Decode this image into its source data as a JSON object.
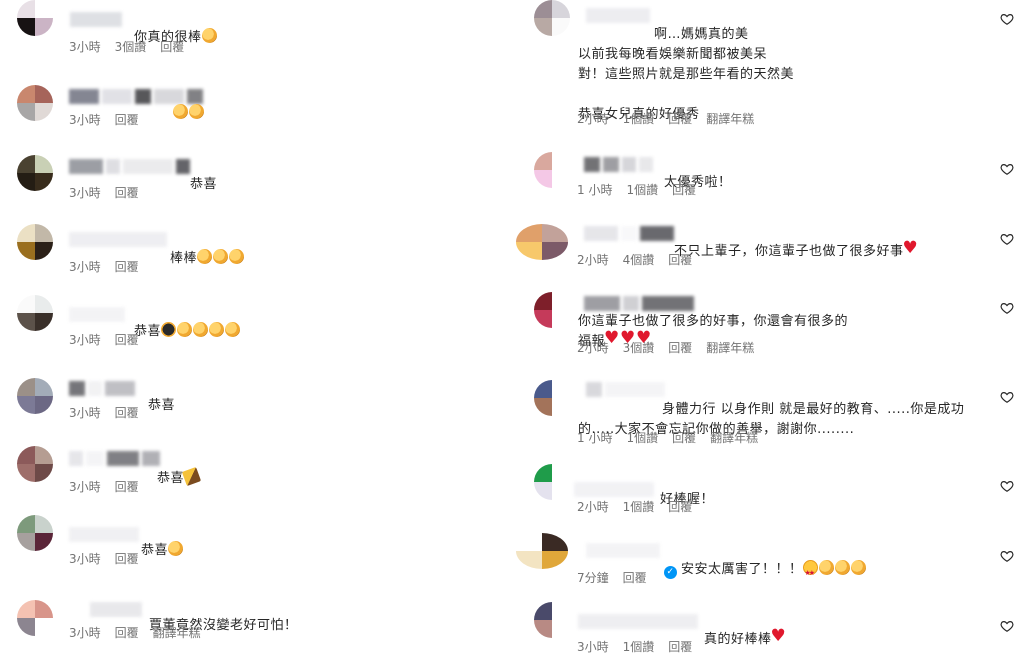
{
  "left_comments": [
    {
      "text": "你真的很棒",
      "emoji": [
        "clap"
      ],
      "time": "3小時",
      "likes": "3個讚",
      "reply": "回覆",
      "translate": ""
    },
    {
      "text": "",
      "emoji": [
        "clap",
        "clap"
      ],
      "time": "3小時",
      "likes": "",
      "reply": "回覆",
      "translate": ""
    },
    {
      "text": "恭喜",
      "emoji": [],
      "time": "3小時",
      "likes": "",
      "reply": "回覆",
      "translate": ""
    },
    {
      "text": "棒棒",
      "emoji": [
        "clap",
        "clap",
        "clap"
      ],
      "time": "3小時",
      "likes": "",
      "reply": "回覆",
      "translate": ""
    },
    {
      "text": "恭喜",
      "emoji": [
        "blackclap",
        "clap",
        "clap",
        "clap",
        "clap"
      ],
      "time": "3小時",
      "likes": "",
      "reply": "回覆",
      "translate": ""
    },
    {
      "text": "恭喜",
      "emoji": [],
      "time": "3小時",
      "likes": "",
      "reply": "回覆",
      "translate": ""
    },
    {
      "text": "恭喜",
      "emoji": [
        "party"
      ],
      "time": "3小時",
      "likes": "",
      "reply": "回覆",
      "translate": ""
    },
    {
      "text": "恭喜",
      "emoji": [
        "clap"
      ],
      "time": "3小時",
      "likes": "",
      "reply": "回覆",
      "translate": ""
    },
    {
      "text": "賈董竟然沒變老好可怕！",
      "emoji": [],
      "time": "3小時",
      "likes": "",
      "reply": "回覆",
      "translate": "翻譯年糕"
    }
  ],
  "right_comments": [
    {
      "text": "啊…媽媽真的美\n以前我每晚看娛樂新聞都被美呆\n對！這些照片就是那些年看的天然美\n\n恭喜女兒真的好優秀",
      "emoji": [],
      "time": "2小時",
      "likes": "1個讚",
      "reply": "回覆",
      "translate": "翻譯年糕"
    },
    {
      "text": "太優秀啦！",
      "emoji": [],
      "time": "1 小時",
      "likes": "1個讚",
      "reply": "回覆",
      "translate": ""
    },
    {
      "text": "不只上輩子，你這輩子也做了很多好事",
      "emoji": [
        "redheart"
      ],
      "time": "2小時",
      "likes": "4個讚",
      "reply": "回覆",
      "translate": ""
    },
    {
      "text": "你這輩子也做了很多的好事，你還會有很多的\n福報",
      "emoji": [
        "redheart",
        "redheart",
        "redheart"
      ],
      "time": "2小時",
      "likes": "3個讚",
      "reply": "回覆",
      "translate": "翻譯年糕"
    },
    {
      "text": "身體力行 以身作則 就是最好的教育、.....你是成功\n的.....大家不會忘記你做的善舉，謝謝你........",
      "emoji": [],
      "time": "1 小時",
      "likes": "1個讚",
      "reply": "回覆",
      "translate": "翻譯年糕"
    },
    {
      "text": "好棒喔！",
      "emoji": [],
      "time": "2小時",
      "likes": "1個讚",
      "reply": "回覆",
      "translate": ""
    },
    {
      "text": "安安太厲害了！！！",
      "emoji": [
        "starface",
        "clap",
        "clap",
        "clap"
      ],
      "time": "7分鐘",
      "likes": "",
      "reply": "回覆",
      "translate": ""
    },
    {
      "text": "真的好棒棒",
      "emoji": [
        "redheart"
      ],
      "time": "3小時",
      "likes": "1個讚",
      "reply": "回覆",
      "translate": ""
    }
  ],
  "colors": {
    "text": "#262626",
    "meta": "#737373",
    "heart_outline": "#262626",
    "verified": "#0095f6"
  },
  "icons": {
    "like": "heart-outline-icon",
    "verified": "verified-badge-icon"
  }
}
